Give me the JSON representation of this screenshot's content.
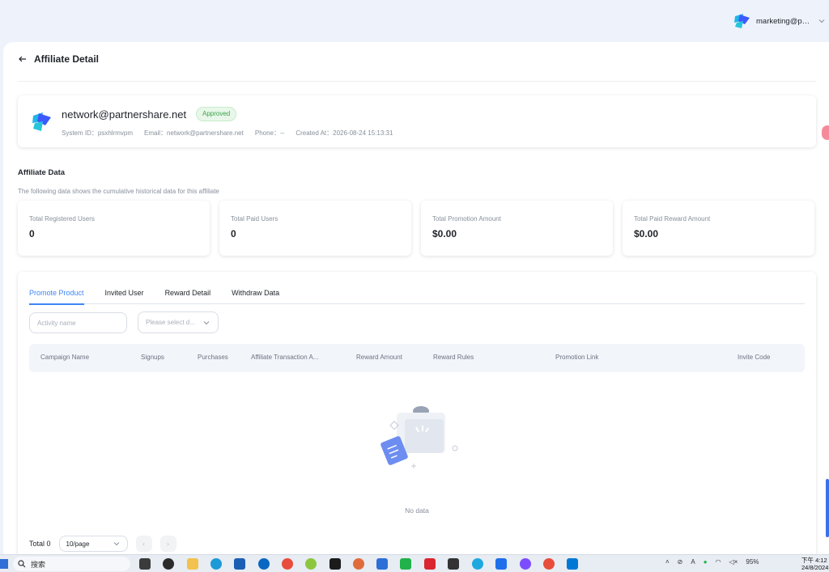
{
  "header": {
    "user_email": "marketing@par...",
    "logo_icon": "brand-logo-icon"
  },
  "page": {
    "title": "Affiliate Detail",
    "back_icon": "arrow-left-icon"
  },
  "profile": {
    "name": "network@partnershare.net",
    "status": "Approved",
    "system_id": "System ID：psxhlrmvpm",
    "email": "Email：network@partnershare.net",
    "phone": "Phone：--",
    "created_at": "Created At：2026-08-24 15:13:31"
  },
  "affiliate_data": {
    "title": "Affiliate Data",
    "description": "The following data shows the cumulative historical data for this affiliate",
    "stats": [
      {
        "label": "Total Registered Users",
        "value": "0"
      },
      {
        "label": "Total Paid Users",
        "value": "0"
      },
      {
        "label": "Total Promotion Amount",
        "value": "$0.00"
      },
      {
        "label": "Total Paid Reward Amount",
        "value": "$0.00"
      }
    ]
  },
  "tabs": [
    {
      "label": "Promote Product",
      "active": true
    },
    {
      "label": "Invited User",
      "active": false
    },
    {
      "label": "Reward Detail",
      "active": false
    },
    {
      "label": "Withdraw Data",
      "active": false
    }
  ],
  "filters": {
    "activity_placeholder": "Activity name",
    "select_placeholder": "Please select d..."
  },
  "table": {
    "columns": [
      "Campaign Name",
      "Signups",
      "Purchases",
      "Affiliate Transaction A...",
      "Reward Amount",
      "Reward Rules",
      "Promotion Link",
      "Invite Code"
    ],
    "empty_text": "No data"
  },
  "pagination": {
    "total": "Total 0",
    "page_size": "10/page",
    "prev": "‹",
    "next": "›"
  },
  "taskbar": {
    "search_label": "搜索",
    "battery": "95%",
    "input_method": "A",
    "time": "下午 4:12",
    "date": "24/8/2024"
  },
  "colors": {
    "accent": "#3e86f5",
    "approved": "#3aa447"
  }
}
